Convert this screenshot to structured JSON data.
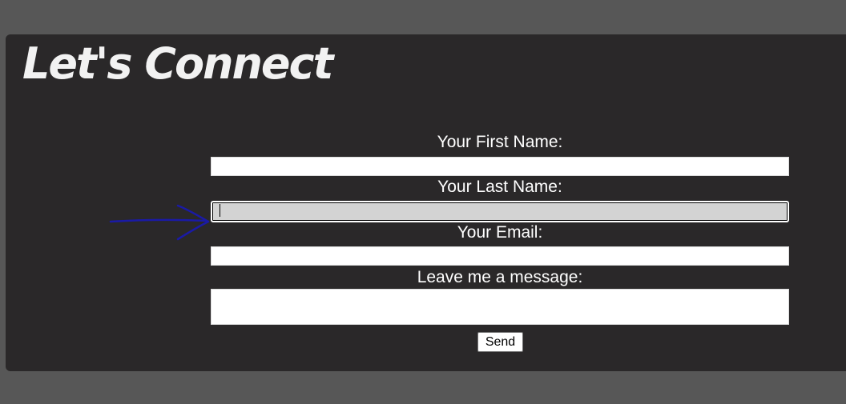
{
  "page": {
    "title": "Let's Connect"
  },
  "form": {
    "first_name_label": "Your First Name:",
    "first_name_value": "",
    "last_name_label": "Your Last Name:",
    "last_name_value": "",
    "email_label": "Your Email:",
    "email_value": "",
    "message_label": "Leave me a message:",
    "message_value": "",
    "send_label": "Send"
  },
  "colors": {
    "page_background": "#575757",
    "panel_background": "#2a2829",
    "focused_field": "#d3d3d3",
    "annotation_arrow": "#1a1aa6"
  },
  "annotation": {
    "icon": "hand-drawn-arrow-icon",
    "points_to": "last-name-input"
  }
}
